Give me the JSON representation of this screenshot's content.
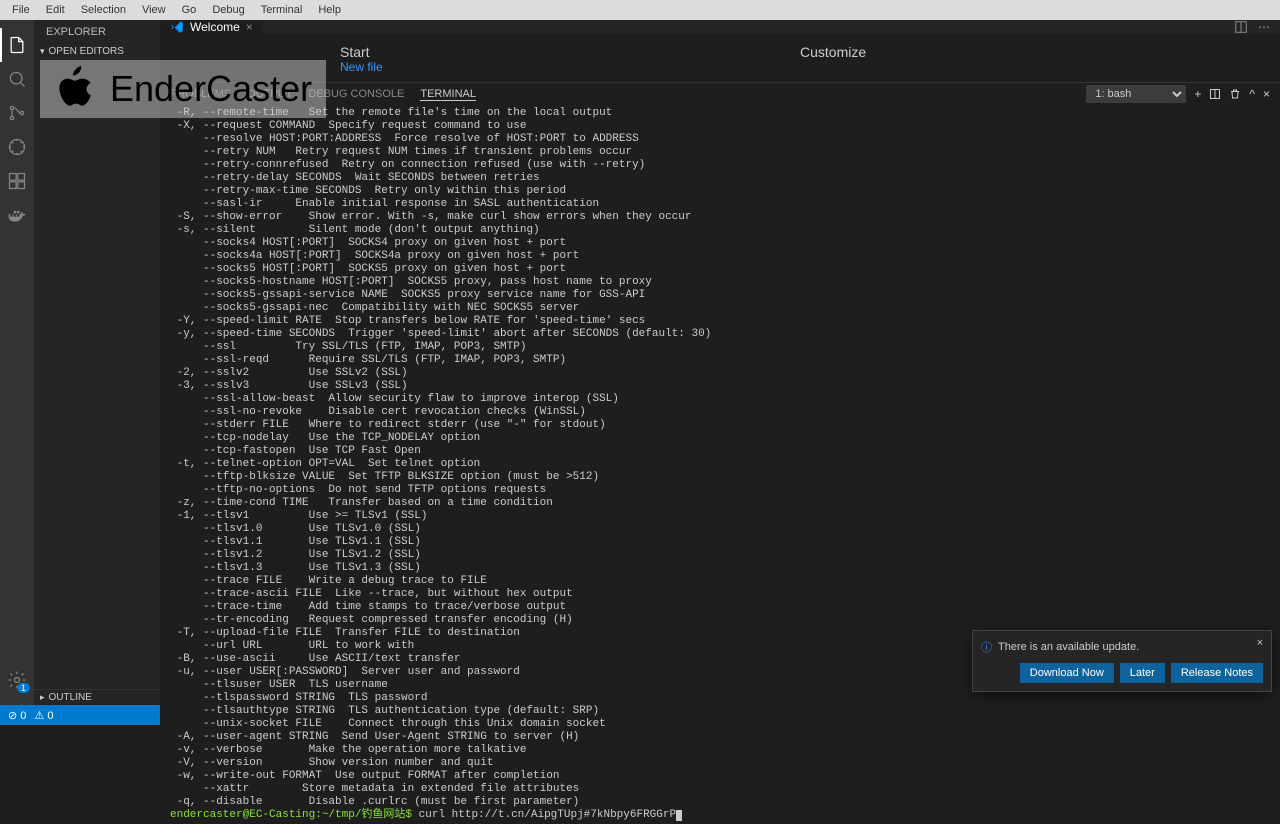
{
  "menu": [
    "File",
    "Edit",
    "Selection",
    "View",
    "Go",
    "Debug",
    "Terminal",
    "Help"
  ],
  "sidebar": {
    "title": "EXPLORER",
    "sections": {
      "open_editors": "OPEN EDITORS",
      "outline": "OUTLINE"
    }
  },
  "tab": {
    "name": "Welcome"
  },
  "welcome": {
    "start": "Start",
    "newfile": "New file",
    "customize": "Customize"
  },
  "watermark": "EnderCaster",
  "terminal": {
    "tabs": {
      "problems": "PROBLEMS",
      "output": "OUTPUT",
      "debug": "DEBUG CONSOLE",
      "terminal": "TERMINAL"
    },
    "shell": "1: bash",
    "lines": [
      " -R, --remote-time   Set the remote file's time on the local output",
      " -X, --request COMMAND  Specify request command to use",
      "     --resolve HOST:PORT:ADDRESS  Force resolve of HOST:PORT to ADDRESS",
      "     --retry NUM   Retry request NUM times if transient problems occur",
      "     --retry-connrefused  Retry on connection refused (use with --retry)",
      "     --retry-delay SECONDS  Wait SECONDS between retries",
      "     --retry-max-time SECONDS  Retry only within this period",
      "     --sasl-ir     Enable initial response in SASL authentication",
      " -S, --show-error    Show error. With -s, make curl show errors when they occur",
      " -s, --silent        Silent mode (don't output anything)",
      "     --socks4 HOST[:PORT]  SOCKS4 proxy on given host + port",
      "     --socks4a HOST[:PORT]  SOCKS4a proxy on given host + port",
      "     --socks5 HOST[:PORT]  SOCKS5 proxy on given host + port",
      "     --socks5-hostname HOST[:PORT]  SOCKS5 proxy, pass host name to proxy",
      "     --socks5-gssapi-service NAME  SOCKS5 proxy service name for GSS-API",
      "     --socks5-gssapi-nec  Compatibility with NEC SOCKS5 server",
      " -Y, --speed-limit RATE  Stop transfers below RATE for 'speed-time' secs",
      " -y, --speed-time SECONDS  Trigger 'speed-limit' abort after SECONDS (default: 30)",
      "     --ssl         Try SSL/TLS (FTP, IMAP, POP3, SMTP)",
      "     --ssl-reqd      Require SSL/TLS (FTP, IMAP, POP3, SMTP)",
      " -2, --sslv2         Use SSLv2 (SSL)",
      " -3, --sslv3         Use SSLv3 (SSL)",
      "     --ssl-allow-beast  Allow security flaw to improve interop (SSL)",
      "     --ssl-no-revoke    Disable cert revocation checks (WinSSL)",
      "     --stderr FILE   Where to redirect stderr (use \"-\" for stdout)",
      "     --tcp-nodelay   Use the TCP_NODELAY option",
      "     --tcp-fastopen  Use TCP Fast Open",
      " -t, --telnet-option OPT=VAL  Set telnet option",
      "     --tftp-blksize VALUE  Set TFTP BLKSIZE option (must be >512)",
      "     --tftp-no-options  Do not send TFTP options requests",
      " -z, --time-cond TIME   Transfer based on a time condition",
      " -1, --tlsv1         Use >= TLSv1 (SSL)",
      "     --tlsv1.0       Use TLSv1.0 (SSL)",
      "     --tlsv1.1       Use TLSv1.1 (SSL)",
      "     --tlsv1.2       Use TLSv1.2 (SSL)",
      "     --tlsv1.3       Use TLSv1.3 (SSL)",
      "     --trace FILE    Write a debug trace to FILE",
      "     --trace-ascii FILE  Like --trace, but without hex output",
      "     --trace-time    Add time stamps to trace/verbose output",
      "     --tr-encoding   Request compressed transfer encoding (H)",
      " -T, --upload-file FILE  Transfer FILE to destination",
      "     --url URL       URL to work with",
      " -B, --use-ascii     Use ASCII/text transfer",
      " -u, --user USER[:PASSWORD]  Server user and password",
      "     --tlsuser USER  TLS username",
      "     --tlspassword STRING  TLS password",
      "     --tlsauthtype STRING  TLS authentication type (default: SRP)",
      "     --unix-socket FILE    Connect through this Unix domain socket",
      " -A, --user-agent STRING  Send User-Agent STRING to server (H)",
      " -v, --verbose       Make the operation more talkative",
      " -V, --version       Show version number and quit",
      " -w, --write-out FORMAT  Use output FORMAT after completion",
      "     --xattr        Store metadata in extended file attributes",
      " -q, --disable       Disable .curlrc (must be first parameter)"
    ],
    "prompt": "endercaster@EC-Casting:~/tmp/钓鱼网站$",
    "command": " curl http://t.cn/AipgTUpj#7kNbpy6FRGGrP"
  },
  "notification": {
    "message": "There is an available update.",
    "buttons": {
      "download": "Download Now",
      "later": "Later",
      "release": "Release Notes"
    }
  },
  "statusbar": {
    "errors": "0",
    "warnings": "0",
    "bell": "1"
  }
}
